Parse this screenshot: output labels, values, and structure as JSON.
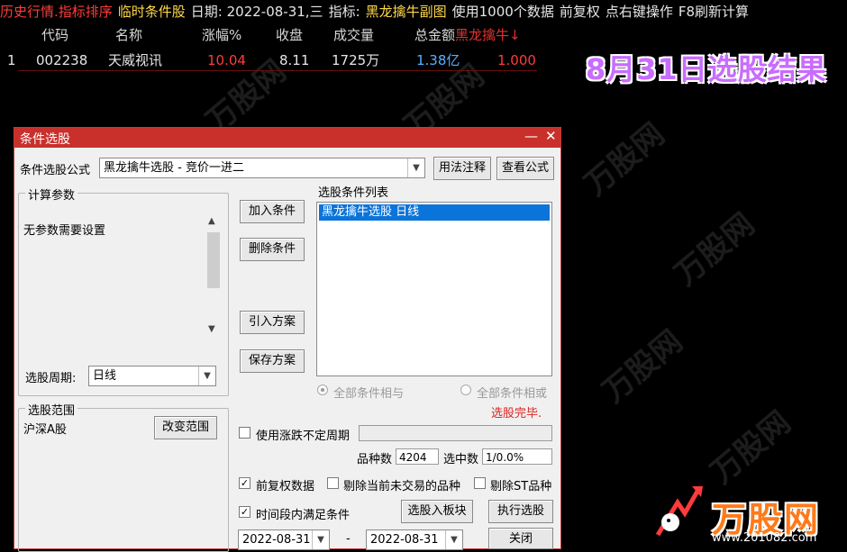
{
  "header": {
    "segments": [
      {
        "text": "历史行情.指标排序",
        "color": "#ff3b3b"
      },
      {
        "text": "临时条件股",
        "color": "#ffd84a"
      },
      {
        "text": "日期: 2022-08-31,三",
        "color": "#e6e6e6"
      },
      {
        "text": "指标:",
        "color": "#e6e6e6"
      },
      {
        "text": "黑龙擒牛副图",
        "color": "#ffd84a"
      },
      {
        "text": "使用1000个数据",
        "color": "#e6e6e6"
      },
      {
        "text": "前复权",
        "color": "#e6e6e6"
      },
      {
        "text": "点右键操作",
        "color": "#e6e6e6"
      },
      {
        "text": "F8刷新计算",
        "color": "#e6e6e6"
      }
    ]
  },
  "table": {
    "columns": [
      "代码",
      "名称",
      "涨幅%",
      "收盘",
      "成交量",
      "总金额",
      "黑龙擒牛↓"
    ],
    "rows": [
      {
        "idx": "1",
        "code": "002238",
        "name": "天威视讯",
        "change": "10.04",
        "close": "8.11",
        "volume": "1725万",
        "amount": "1.38亿",
        "indicator": "1.000"
      }
    ]
  },
  "result_banner": "8月31日选股结果",
  "watermark_text": "万股网",
  "dialog": {
    "title": "条件选股",
    "minimize_glyph": "—",
    "close_glyph": "✕",
    "formula_label": "条件选股公式",
    "formula_value": "黑龙擒牛选股 - 竞价一进二",
    "usage_button": "用法注释",
    "view_formula_button": "查看公式",
    "params_group_title": "计算参数",
    "params_text": "无参数需要设置",
    "period_label": "选股周期:",
    "period_value": "日线",
    "scope_group_title": "选股范围",
    "scope_value": "沪深A股",
    "change_scope_button": "改变范围",
    "add_condition_button": "加入条件",
    "delete_condition_button": "删除条件",
    "import_plan_button": "引入方案",
    "save_plan_button": "保存方案",
    "condition_list_label": "选股条件列表",
    "condition_items": [
      "黑龙擒牛选股  日线"
    ],
    "radio_and": "全部条件相与",
    "radio_or": "全部条件相或",
    "status_text": "选股完毕.",
    "uncertain_period_label": "使用涨跌不定周期",
    "count_label": "品种数",
    "count_value": "4204",
    "selected_label": "选中数",
    "selected_value": "1/0.0%",
    "forward_adjust_label": "前复权数据",
    "exclude_untraded_label": "剔除当前未交易的品种",
    "exclude_st_label": "剔除ST品种",
    "period_satisfy_label": "时间段内满足条件",
    "select_to_block_button": "选股入板块",
    "execute_button": "执行选股",
    "date_from": "2022-08-31",
    "date_to": "2022-08-31",
    "date_separator": "-",
    "close_button": "关闭"
  },
  "logo": {
    "text": "万股网",
    "url": "www.201082.com"
  },
  "colors": {
    "status": "#e02020",
    "selection": "#0a74da",
    "titlebar": "#c9302c"
  }
}
